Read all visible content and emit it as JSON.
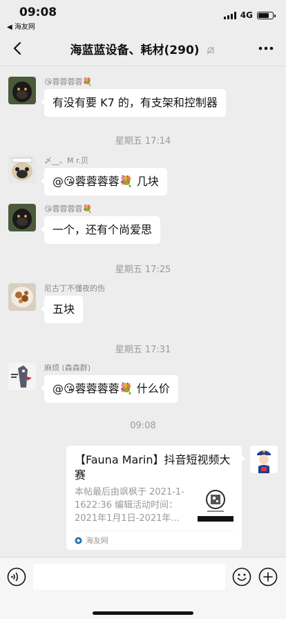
{
  "status_bar": {
    "time": "09:08",
    "back_app": "◀ 海友网",
    "network": "4G",
    "signal_icon": "signal-bars-icon",
    "battery_icon": "battery-icon",
    "battery_level": 0.75
  },
  "nav": {
    "back_icon": "chevron-left-icon",
    "title": "海蓝蓝设备、耗材(290)",
    "mute_icon": "bell-off-icon",
    "more_icon": "more-dots-icon"
  },
  "messages": [
    {
      "sender": "😘蓉蓉蓉蓉💐",
      "text": "有没有要 K7 的，有支架和控制器",
      "avatar": "monkey-avatar"
    },
    {
      "time": "星期五 17:14"
    },
    {
      "sender": "〆__、M r.贝",
      "text": "@😘蓉蓉蓉蓉💐 几块",
      "avatar": "pug-avatar"
    },
    {
      "sender": "😘蓉蓉蓉蓉💐",
      "text": "一个，还有个尚爱思",
      "avatar": "monkey-avatar"
    },
    {
      "time": "星期五 17:25"
    },
    {
      "sender": "尼古丁不懂夜的伤",
      "text": "五块",
      "avatar": "food-avatar"
    },
    {
      "time": "星期五 17:31"
    },
    {
      "sender": "麻烦 (森森群)",
      "text": "@😘蓉蓉蓉蓉💐 什么价",
      "avatar": "cartoon-avatar"
    },
    {
      "time": "09:08"
    }
  ],
  "card": {
    "title": "【Fauna Marin】抖音短视频大赛",
    "description": "本帖最后由飒枫于 2021-1-1622:36 编辑活动时间：2021年1月1日-2021年...",
    "source": "海友网",
    "source_icon": "haiyouwang-logo-icon",
    "thumb": "qr-thumbnail",
    "avatar": "police-cartoon-avatar"
  },
  "input_bar": {
    "voice_icon": "voice-icon",
    "emoji_icon": "emoji-icon",
    "plus_icon": "plus-circle-icon"
  }
}
